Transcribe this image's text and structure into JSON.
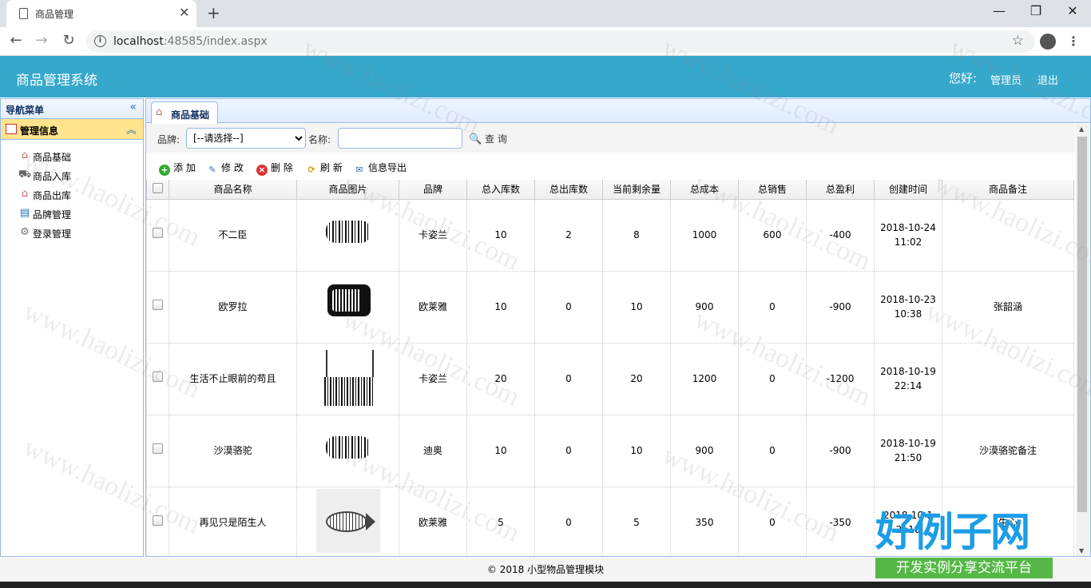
{
  "browser": {
    "tab_title": "商品管理",
    "url_host": "localhost",
    "url_rest": ":48585/index.aspx"
  },
  "header": {
    "system_name": "商品管理系统",
    "greeting": "您好:",
    "user": "管理员",
    "logout": "退出"
  },
  "sidebar": {
    "title": "导航菜单",
    "group": "管理信息",
    "items": [
      {
        "label": "商品基础",
        "icon": "home-icon"
      },
      {
        "label": "商品入库",
        "icon": "cart-icon"
      },
      {
        "label": "商品出库",
        "icon": "home-icon"
      },
      {
        "label": "品牌管理",
        "icon": "book-icon"
      },
      {
        "label": "登录管理",
        "icon": "gear-icon"
      }
    ]
  },
  "main": {
    "tab": "商品基础",
    "filter": {
      "brand_label": "品牌:",
      "brand_selected": "[--请选择--]",
      "name_label": "名称:",
      "name_value": "",
      "query": "查 询"
    },
    "actions": {
      "add": "添 加",
      "edit": "修 改",
      "delete": "删 除",
      "refresh": "刷 新",
      "export": "信息导出"
    }
  },
  "table": {
    "columns": [
      "商品名称",
      "商品图片",
      "品牌",
      "总入库数",
      "总出库数",
      "当前剩余量",
      "总成本",
      "总销售",
      "总盈利",
      "创建时间",
      "商品备注"
    ],
    "rows": [
      {
        "name": "不二臣",
        "image": "barcode-art",
        "brand": "卡姿兰",
        "in": "10",
        "out": "2",
        "remain": "8",
        "cost": "1000",
        "sales": "600",
        "profit": "-400",
        "date": "2018-10-24",
        "time": "11:02",
        "note": ""
      },
      {
        "name": "欧罗拉",
        "image": "tv-barcode",
        "brand": "欧莱雅",
        "in": "10",
        "out": "0",
        "remain": "10",
        "cost": "900",
        "sales": "0",
        "profit": "-900",
        "date": "2018-10-23",
        "time": "10:38",
        "note": "张韶涵"
      },
      {
        "name": "生活不止眼前的苟且",
        "image": "tree-barcode",
        "brand": "卡姿兰",
        "in": "20",
        "out": "0",
        "remain": "20",
        "cost": "1200",
        "sales": "0",
        "profit": "-1200",
        "date": "2018-10-19",
        "time": "22:14",
        "note": ""
      },
      {
        "name": "沙漠骆驼",
        "image": "barcode-art",
        "brand": "迪奥",
        "in": "10",
        "out": "0",
        "remain": "10",
        "cost": "900",
        "sales": "0",
        "profit": "-900",
        "date": "2018-10-19",
        "time": "21:50",
        "note": "沙漠骆驼备注"
      },
      {
        "name": "再见只是陌生人",
        "image": "fish-barcode",
        "brand": "欧莱雅",
        "in": "5",
        "out": "0",
        "remain": "5",
        "cost": "350",
        "sales": "0",
        "profit": "-350",
        "date": "2018-10-1",
        "time": "2 :10",
        "note": "生心"
      }
    ]
  },
  "footer": "© 2018 小型物品管理模块",
  "watermark": "www.haolizi.com",
  "logo": {
    "big": "好例子网",
    "small": "开发实例分享交流平台"
  }
}
